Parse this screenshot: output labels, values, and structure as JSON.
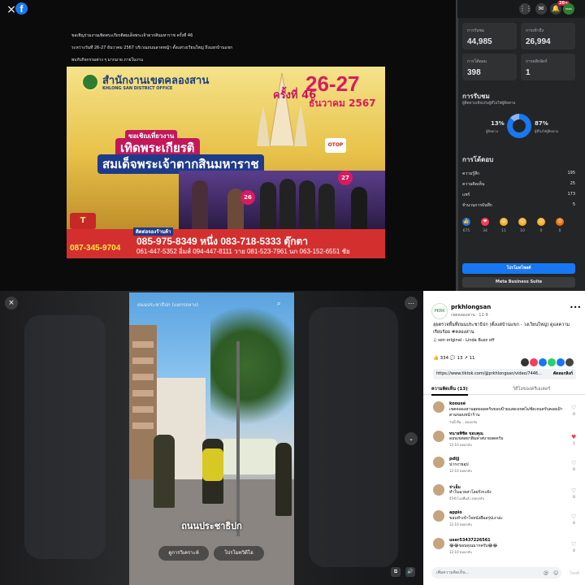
{
  "viewer": {
    "close_icon": "×",
    "fb_logo": "f",
    "post_lines": [
      "ขอเชิญร่วมงานเทิดพระเกียรติสมเด็จพระเจ้าตากสินมหาราช ครั้งที่ 46",
      "ระหว่างวันที่ 26-27 ธันวาคม 2567 บริเวณถนนลาดหญ้า ตั้งแต่วงเวียนใหญ่ ถึงแยกบ้านแขก",
      "พบกับกิจกรรมต่าง ๆ มากมาย ภายในงาน"
    ],
    "banner": {
      "office_th": "สำนักงานเขตคลองสาน",
      "office_en": "KHLONG SAN DISTRICT OFFICE",
      "edition": "ครั้งที่ 46",
      "dates": "26-27",
      "month": "ธันวาคม 2567",
      "invite": "ขอเชิญเที่ยวงาน",
      "title1": "เทิดพระเกียรติ",
      "title2": "สมเด็จพระเจ้าตากสินมหาราช",
      "otop": "OTOP",
      "day27": "27",
      "day26": "26",
      "logo_left": "T",
      "contact_label": "ติดต่อจองร้านค้า",
      "phone_main": "085-975-8349 หนึ่ง   083-718-5333 ตุ๊กตา",
      "phone_left": "087-345-9704",
      "phone_list": "061-447-5352 อิ่มส์   094-447-8111 วาย   081-523-7961 นก   063-152-6551 ชัย"
    }
  },
  "topbar": {
    "grid_icon": "⋮⋮",
    "messenger_icon": "✉",
    "bell_icon": "🔔",
    "badge": "20+",
    "avatar_text": "PKRK"
  },
  "insights": {
    "cards": [
      {
        "label": "การรับชม",
        "value": "44,985"
      },
      {
        "label": "การเข้าถึง",
        "value": "26,994"
      },
      {
        "label": "การโต้ตอบ",
        "value": "398"
      },
      {
        "label": "การคลิกลิงก์",
        "value": "1"
      }
    ],
    "views_title": "การรับชม",
    "views_sub": "ผู้ติดตามเทียบกับผู้ที่ไม่ใช่ผู้ติดตาม",
    "followers_pct": "13%",
    "followers_lbl": "ผู้ติดตาม",
    "nonfollowers_pct": "87%",
    "nonfollowers_lbl": "ผู้ที่ไม่ใช่ผู้ติดตาม",
    "donut_fraction": 0.87,
    "engagement_title": "การโต้ตอบ",
    "rows": [
      {
        "label": "ความรู้สึก",
        "value": "195"
      },
      {
        "label": "ความคิดเห็น",
        "value": "25"
      },
      {
        "label": "แชร์",
        "value": "173"
      },
      {
        "label": "จำนวนการบันทึก",
        "value": "5"
      }
    ],
    "reactions": [
      {
        "icon": "👍",
        "count": "675",
        "color": "#1877f2"
      },
      {
        "icon": "❤",
        "count": "34",
        "color": "#f33e58"
      },
      {
        "icon": "😆",
        "count": "11",
        "color": "#f7b125"
      },
      {
        "icon": "😮",
        "count": "10",
        "color": "#f7b125"
      },
      {
        "icon": "😢",
        "count": "0",
        "color": "#f7b125"
      },
      {
        "icon": "😡",
        "count": "0",
        "color": "#e9710f"
      }
    ],
    "promote_label": "โปรโมทโพสต์",
    "suite_label": "Meta Business Suite"
  },
  "video": {
    "close_icon": "×",
    "more_icon": "…",
    "down_icon": "⌄",
    "top_label": "ถนนประชาธิปก (แยกรถลาง)",
    "search_icon": "⌕",
    "caption": "ถนนประชาธิปก",
    "insights_btn": "ดูการวิเคราะห์",
    "promote_btn": "โปรโมทวิดีโอ",
    "ctrl_icons": [
      "⧉",
      "🔊"
    ]
  },
  "side": {
    "avatar_text": "PKRK",
    "username": "prkhlongsan",
    "userinfo": "เขตคลองสาน · 12-9",
    "more_icon": "•••",
    "description": "ลุยตรวจพื้นที่ถนนประชาธิปก (ตั้งแต่บ้านแขก - วงเวียนใหญ่) ดูแลความเรียบร้อย #คลองสาน",
    "music": "♫ son original - Linda Buzz off",
    "stats": "👍 334   💬 13   ↗ 11",
    "share_colors": [
      "#333",
      "#f33e58",
      "#1877f2",
      "#25d366",
      "#1877f2",
      "#444"
    ],
    "link": "https://www.tiktok.com/@prkhlongsan/video/7446...",
    "copy_label": "คัดลอกลิงก์",
    "tab_comments": "ความคิดเห็น (13)",
    "tab_insights": "วิดีโอของครีเอเตอร์",
    "comments": [
      {
        "name": "koousé",
        "text": "เขตคลองสานสุดยอดครับขอบป้ายแสดงเขตไม่ชัดเจนครับคอยเฝ้าตามขอบหน้าร้าน",
        "meta": "วันนี้  ที่ม...  ตอบกลับ",
        "likes": "0",
        "liked": false
      },
      {
        "name": "ทนายพิชิต ขอบคุณ",
        "text": "ดอบเขตสยาติมล่าสบายลดครับ",
        "meta": "12-10    ตอบกลับ",
        "likes": "1",
        "liked": true
      },
      {
        "name": "pdijj",
        "text": "น่ากงายอุป",
        "meta": "12-10    ตอบกลับ",
        "likes": "0",
        "liked": false
      },
      {
        "name": "จ่าเอ็ม",
        "text": "ทำในฉายสาโลยรั่งระยัง",
        "meta": "45ชั่วโมงที่แล้ว    ตอบกลับ",
        "likes": "0",
        "liked": false
      },
      {
        "name": "appio",
        "text": "ขอบทำเข้าใจหนังสืออรุ่ปเงาล่ะ",
        "meta": "12-10    ตอบกลับ",
        "likes": "0",
        "liked": false
      },
      {
        "name": "user53437226561",
        "text": "😂😂ขอบคุณมากครับ😂😂",
        "meta": "12-10    ตอบกลับ",
        "likes": "0",
        "liked": false
      }
    ],
    "input_placeholder": "เพิ่มความคิดเห็น...",
    "input_icons": [
      "@",
      "☺"
    ],
    "post_label": "โพสต์"
  }
}
